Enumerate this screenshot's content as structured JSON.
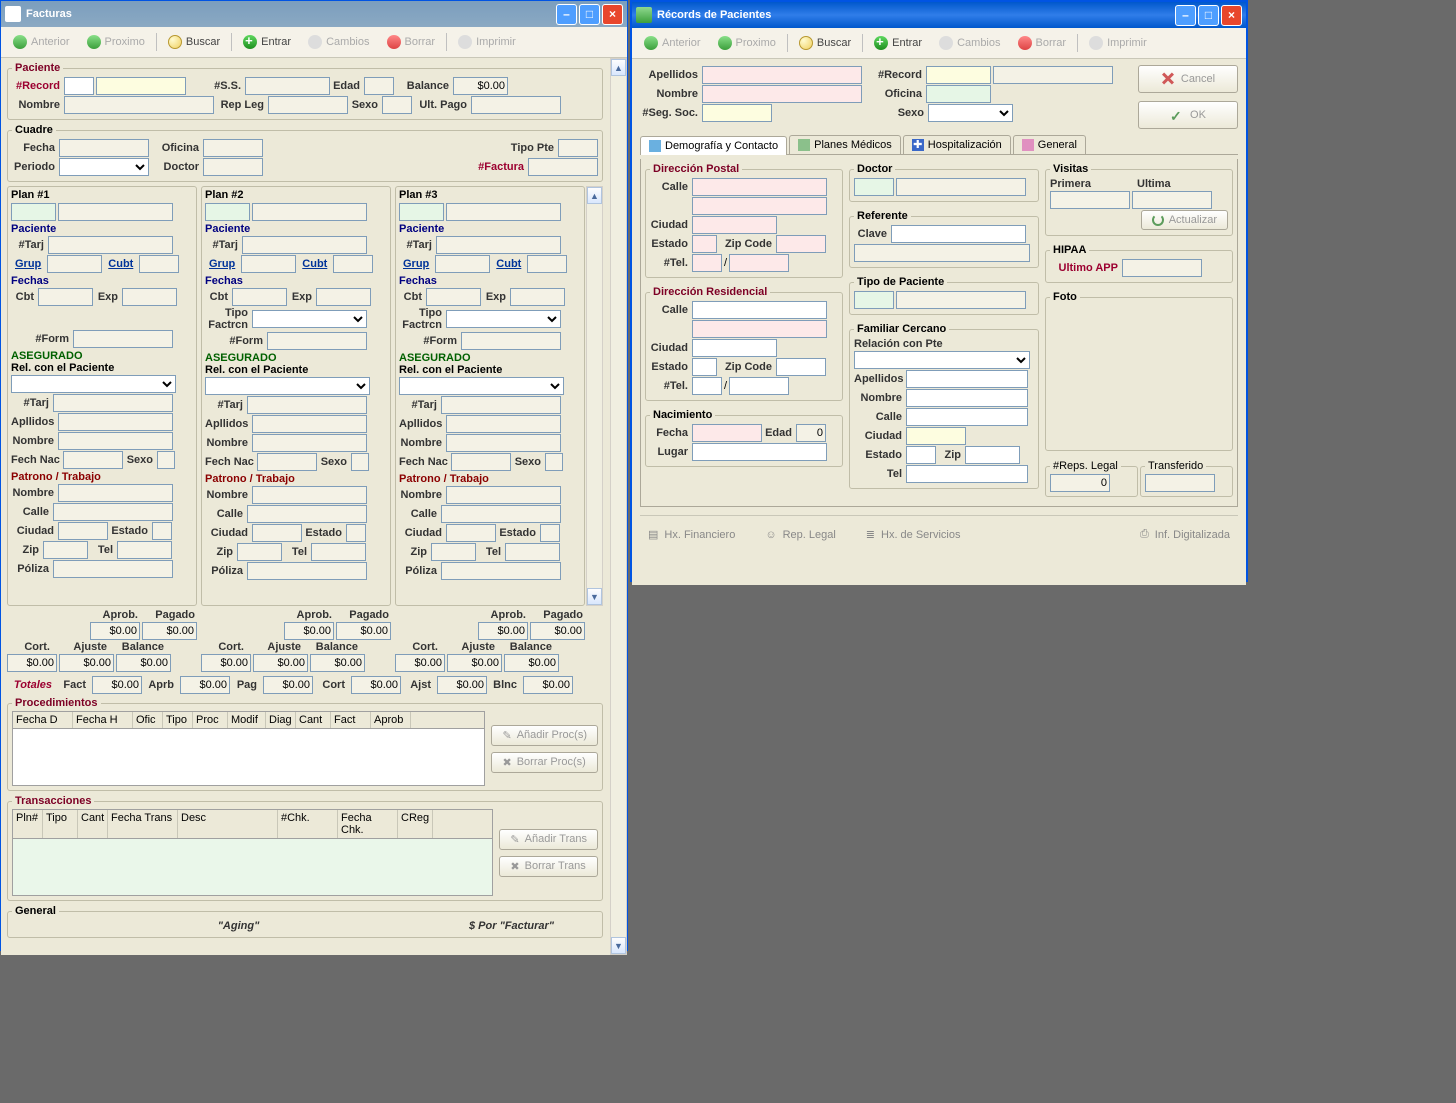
{
  "left": {
    "title": "Facturas",
    "toolbar": [
      "Anterior",
      "Proximo",
      "Buscar",
      "Entrar",
      "Cambios",
      "Borrar",
      "Imprimir"
    ],
    "paciente": {
      "legend": "Paciente",
      "record_lbl": "#Record",
      "ss_lbl": "#S.S.",
      "edad_lbl": "Edad",
      "balance_lbl": "Balance",
      "balance_val": "$0.00",
      "nombre_lbl": "Nombre",
      "repleg_lbl": "Rep Leg",
      "sexo_lbl": "Sexo",
      "ultpago_lbl": "Ult. Pago"
    },
    "cuadre": {
      "legend": "Cuadre",
      "fecha_lbl": "Fecha",
      "oficina_lbl": "Oficina",
      "tipopte_lbl": "Tipo Pte",
      "periodo_lbl": "Periodo",
      "doctor_lbl": "Doctor",
      "factura_lbl": "#Factura"
    },
    "plans": [
      {
        "hd": "Plan #1"
      },
      {
        "hd": "Plan #2"
      },
      {
        "hd": "Plan #3"
      }
    ],
    "plan_labels": {
      "paciente": "Paciente",
      "tarj": "#Tarj",
      "grup": "Grup",
      "cubt": "Cubt",
      "fechas": "Fechas",
      "cbt": "Cbt",
      "exp": "Exp",
      "tipo_factrcn": "Tipo Factrcn",
      "form": "#Form",
      "asegurado": "ASEGURADO",
      "rel_pte": "Rel. con el Paciente",
      "apllidos": "Apllidos",
      "nombre": "Nombre",
      "fechnac": "Fech Nac",
      "sexo": "Sexo",
      "patrono": "Patrono / Trabajo",
      "calle": "Calle",
      "ciudad": "Ciudad",
      "estado": "Estado",
      "zip": "Zip",
      "tel": "Tel",
      "poliza": "Póliza",
      "aprob": "Aprob.",
      "pagado": "Pagado",
      "cort": "Cort.",
      "ajuste": "Ajuste",
      "balance": "Balance",
      "zero": "$0.00"
    },
    "totales": {
      "label": "Totales",
      "fact": "Fact",
      "aprb": "Aprb",
      "pag": "Pag",
      "cort": "Cort",
      "ajst": "Ajst",
      "blnc": "Blnc",
      "val": "$0.00"
    },
    "proc": {
      "legend": "Procedimientos",
      "cols": [
        "Fecha D",
        "Fecha H",
        "Ofic",
        "Tipo",
        "Proc",
        "Modif",
        "Diag",
        "Cant",
        "Fact",
        "Aprob"
      ],
      "add": "Añadir Proc(s)",
      "del": "Borrar Proc(s)"
    },
    "trans": {
      "legend": "Transacciones",
      "cols": [
        "Pln#",
        "Tipo",
        "Cant",
        "Fecha Trans",
        "Desc",
        "#Chk.",
        "Fecha Chk.",
        "CReg"
      ],
      "add": "Añadir Trans",
      "del": "Borrar Trans"
    },
    "general": {
      "legend": "General",
      "aging": "\"Aging\"",
      "por_facturar": "$ Por \"Facturar\""
    }
  },
  "right": {
    "title": "Récords de Pacientes",
    "toolbar": [
      "Anterior",
      "Proximo",
      "Buscar",
      "Entrar",
      "Cambios",
      "Borrar",
      "Imprimir"
    ],
    "hdr": {
      "apellidos": "Apellidos",
      "record": "#Record",
      "nombre": "Nombre",
      "oficina": "Oficina",
      "segsoc": "#Seg. Soc.",
      "sexo": "Sexo",
      "cancel": "Cancel",
      "ok": "OK"
    },
    "tabs": [
      "Demografía y Contacto",
      "Planes Médicos",
      "Hospitalización",
      "General"
    ],
    "dirpostal": {
      "legend": "Dirección Postal",
      "calle": "Calle",
      "ciudad": "Ciudad",
      "estado": "Estado",
      "zip": "Zip Code",
      "tel": "#Tel.",
      "slash": "/"
    },
    "dirres": {
      "legend": "Dirección Residencial"
    },
    "nac": {
      "legend": "Nacimiento",
      "fecha": "Fecha",
      "edad": "Edad",
      "edad_val": "0",
      "lugar": "Lugar"
    },
    "doctor": {
      "legend": "Doctor"
    },
    "referente": {
      "legend": "Referente",
      "clave": "Clave"
    },
    "tipopte": {
      "legend": "Tipo de Paciente"
    },
    "familiar": {
      "legend": "Familiar Cercano",
      "rel": "Relación con Pte",
      "apellidos": "Apellidos",
      "nombre": "Nombre",
      "calle": "Calle",
      "ciudad": "Ciudad",
      "estado": "Estado",
      "zip": "Zip",
      "tel": "Tel"
    },
    "visitas": {
      "legend": "Visitas",
      "primera": "Primera",
      "ultima": "Ultima",
      "actualizar": "Actualizar"
    },
    "hipaa": {
      "legend": "HIPAA",
      "ultimo": "Ultimo APP"
    },
    "foto": {
      "legend": "Foto"
    },
    "reps": {
      "legend": "#Reps. Legal",
      "val": "0",
      "trans": "Transferido"
    },
    "bottom": [
      "Hx. Financiero",
      "Rep. Legal",
      "Hx. de Servicios",
      "Inf. Digitalizada"
    ]
  }
}
